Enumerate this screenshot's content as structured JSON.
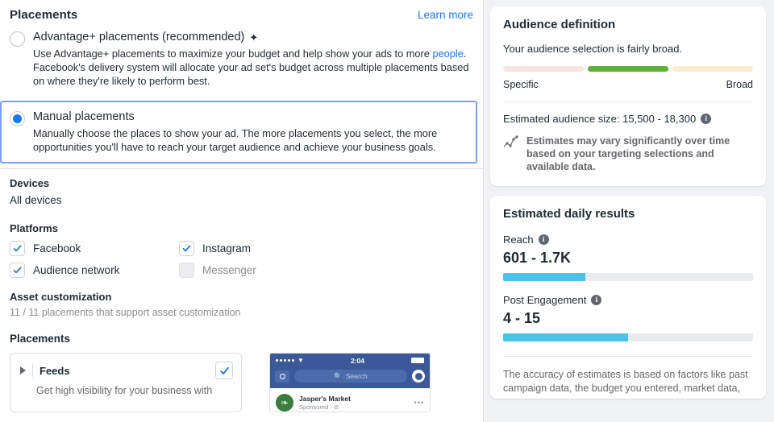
{
  "left": {
    "header": {
      "title": "Placements",
      "learn_more": "Learn more"
    },
    "options": [
      {
        "title": "Advantage+ placements (recommended)",
        "sparkle": "✦",
        "desc_before": "Use Advantage+ placements to maximize your budget and help show your ads to more ",
        "desc_link": "people",
        "desc_after": ". Facebook's delivery system will allocate your ad set's budget across multiple placements based on where they're likely to perform best.",
        "selected": false
      },
      {
        "title": "Manual placements",
        "desc": "Manually choose the places to show your ad. The more placements you select, the more opportunities you'll have to reach your target audience and achieve your business goals.",
        "selected": true
      }
    ],
    "devices": {
      "label": "Devices",
      "value": "All devices"
    },
    "platforms": {
      "label": "Platforms",
      "items": [
        {
          "label": "Facebook",
          "checked": true,
          "disabled": false
        },
        {
          "label": "Instagram",
          "checked": true,
          "disabled": false
        },
        {
          "label": "Audience network",
          "checked": true,
          "disabled": false
        },
        {
          "label": "Messenger",
          "checked": false,
          "disabled": true
        }
      ]
    },
    "asset_customization": {
      "label": "Asset customization",
      "sub": "11 / 11 placements that support asset customization"
    },
    "placements_section": {
      "label": "Placements",
      "card": {
        "name": "Feeds",
        "desc": "Get high visibility for your business with",
        "checked": true
      }
    },
    "phone_preview": {
      "time": "2:04",
      "search_placeholder": "Search",
      "brand": "Jasper's Market",
      "sponsored": "Sponsored · ⊘"
    }
  },
  "right": {
    "audience": {
      "title": "Audience definition",
      "subtitle": "Your audience selection is fairly broad.",
      "gauge": {
        "segments": [
          "#f9e4e0",
          "#5cb335",
          "#fbeccd"
        ],
        "active_index": 1
      },
      "scale_left": "Specific",
      "scale_right": "Broad",
      "estimate_label": "Estimated audience size: 15,500 - 18,300",
      "note": "Estimates may vary significantly over time based on your targeting selections and available data."
    },
    "daily": {
      "title": "Estimated daily results",
      "metrics": [
        {
          "label": "Reach",
          "value": "601 - 1.7K",
          "fill_pct": 33
        },
        {
          "label": "Post Engagement",
          "value": "4 - 15",
          "fill_pct": 50
        }
      ],
      "accuracy": "The accuracy of estimates is based on factors like past campaign data, the budget you entered, market data,"
    }
  }
}
